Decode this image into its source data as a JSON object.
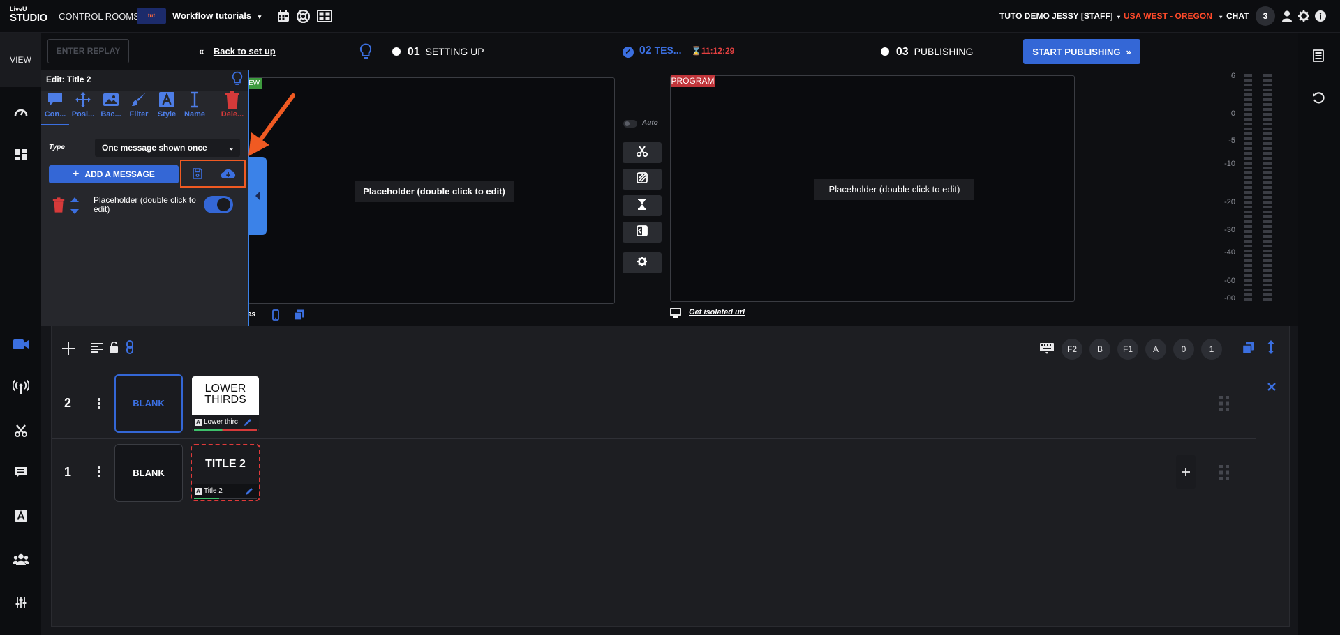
{
  "topbar": {
    "logo_top": "LiveU",
    "logo_bottom": "STUDIO",
    "control_rooms": "CONTROL ROOMS",
    "room_badge": "tut",
    "room_name": "Workflow tutorials",
    "user_label": "TUTO DEMO JESSY [STAFF]",
    "region": "USA WEST - OREGON",
    "chat_label": "CHAT",
    "chat_count": "3",
    "region_color": "#ff4a2a"
  },
  "left_rail": {
    "view_label": "VIEW"
  },
  "workflow": {
    "enter_replay": "ENTER REPLAY",
    "back_link": "Back to set up",
    "step1_num": "01",
    "step1_label": "SETTING UP",
    "step2_num": "02",
    "step2_label": "TES...",
    "timer": "11:12:29",
    "step3_num": "03",
    "step3_label": "PUBLISHING",
    "start_publishing": "START PUBLISHING"
  },
  "edit_panel": {
    "title": "Edit: Title 2",
    "tabs": [
      {
        "label": "Con...",
        "icon": "comment-icon"
      },
      {
        "label": "Posi...",
        "icon": "move-icon"
      },
      {
        "label": "Bac...",
        "icon": "image-icon"
      },
      {
        "label": "Filter",
        "icon": "brush-icon"
      },
      {
        "label": "Style",
        "icon": "font-icon"
      },
      {
        "label": "Name",
        "icon": "text-cursor-icon"
      },
      {
        "label": "Dele...",
        "icon": "trash-icon"
      }
    ],
    "type_label": "Type",
    "type_value": "One message shown once",
    "add_message": "ADD A MESSAGE",
    "message_text": "Placeholder (double click to edit)"
  },
  "preview": {
    "tag": "EW",
    "placeholder": "Placeholder (double click to edit)",
    "footer_text": "es"
  },
  "switcher": {
    "auto_label": "Auto"
  },
  "program": {
    "tag": "PROGRAM",
    "placeholder": "Placeholder (double click to edit)",
    "isolated_url": "Get isolated url"
  },
  "audio_meter": {
    "ticks": [
      "6",
      "0",
      "-5",
      "-10",
      "-20",
      "-30",
      "-40",
      "-60",
      "-00"
    ]
  },
  "rundown_toolbar": {
    "keys": [
      "F2",
      "B",
      "F1",
      "A",
      "0",
      "1"
    ]
  },
  "rows": [
    {
      "num": "2",
      "blank_label": "BLANK",
      "card_title": "LOWER THIRDS",
      "card_name": "Lower thirc"
    },
    {
      "num": "1",
      "blank_label": "BLANK",
      "card_title": "TITLE 2",
      "card_name": "Title 2"
    }
  ],
  "colors": {
    "accent": "#3467d6",
    "danger": "#d63a3a",
    "highlight_box": "#f05a22"
  }
}
